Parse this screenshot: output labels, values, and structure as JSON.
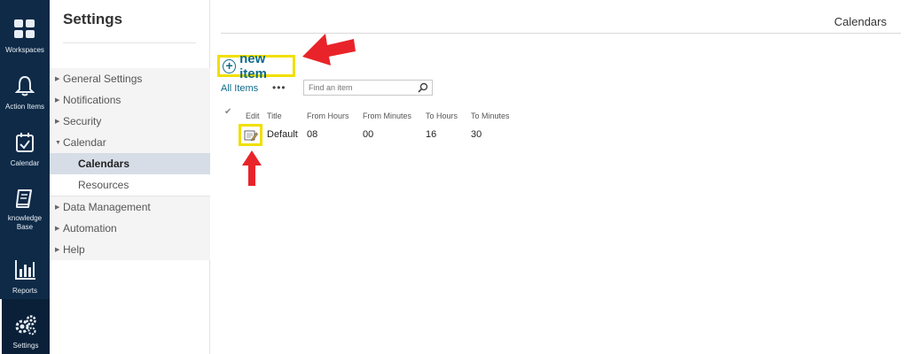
{
  "rail": {
    "items": [
      {
        "label": "Workspaces",
        "icon": "grid-icon"
      },
      {
        "label": "Action Items",
        "icon": "bell-icon"
      },
      {
        "label": "Calendar",
        "icon": "calendar-icon"
      },
      {
        "label": "knowledge Base",
        "icon": "book-icon"
      },
      {
        "label": "Reports",
        "icon": "bar-chart-icon"
      },
      {
        "label": "Settings",
        "icon": "gears-icon"
      }
    ]
  },
  "settings": {
    "title": "Settings",
    "nav": {
      "general": "General Settings",
      "notifications": "Notifications",
      "security": "Security",
      "calendar": "Calendar",
      "calendars": "Calendars",
      "resources": "Resources",
      "data_management": "Data Management",
      "automation": "Automation",
      "help": "Help"
    }
  },
  "main": {
    "page_title": "Calendars",
    "new_item": "new item",
    "all_items": "All Items",
    "more": "•••",
    "search_placeholder": "Find an item",
    "columns": {
      "edit": "Edit",
      "title": "Title",
      "from_hours": "From Hours",
      "from_minutes": "From Minutes",
      "to_hours": "To Hours",
      "to_minutes": "To Minutes"
    },
    "rows": [
      {
        "title": "Default",
        "from_hours": "08",
        "from_minutes": "00",
        "to_hours": "16",
        "to_minutes": "30"
      }
    ]
  },
  "colors": {
    "rail_bg": "#0e2a47",
    "link": "#0f6b8c",
    "highlight": "#f0e000",
    "arrow": "#e8242a"
  }
}
